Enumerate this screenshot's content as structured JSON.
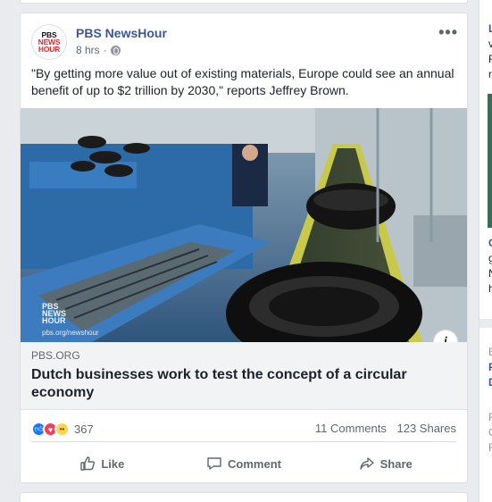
{
  "post": {
    "page_name": "PBS NewsHour",
    "time": "8 hrs",
    "time_separator": "·",
    "avatar_logo": [
      "PBS",
      "NEWS",
      "HOUR"
    ],
    "more_label": "•••",
    "text": "\"By getting more value out of existing materials, Europe could see an annual benefit of up to $2 trillion by 2030,\" reports Jeffrey Brown.",
    "media": {
      "overlay_logo": [
        "PBS",
        "NEWS",
        "HOUR"
      ],
      "overlay_url": "pbs.org/newshour",
      "info_label": "i"
    },
    "link": {
      "domain": "PBS.ORG",
      "title": "Dutch businesses work to test the concept of a circular economy"
    },
    "stats": {
      "reaction_count": "367",
      "comments": "11 Comments",
      "shares": "123 Shares"
    },
    "actions": {
      "like": "Like",
      "comment": "Comment",
      "share": "Share"
    }
  },
  "right_column": {
    "lines": [
      "L",
      "v",
      "F",
      "r",
      "G",
      "g",
      "N",
      "h",
      "E",
      "F",
      "D",
      "F",
      "C",
      "F"
    ]
  },
  "colors": {
    "page_bg": "#e9ebee",
    "brand_link": "#385898",
    "like_blue": "#1877f2",
    "love_red": "#f33e58",
    "wow_yellow": "#fcd34d"
  }
}
